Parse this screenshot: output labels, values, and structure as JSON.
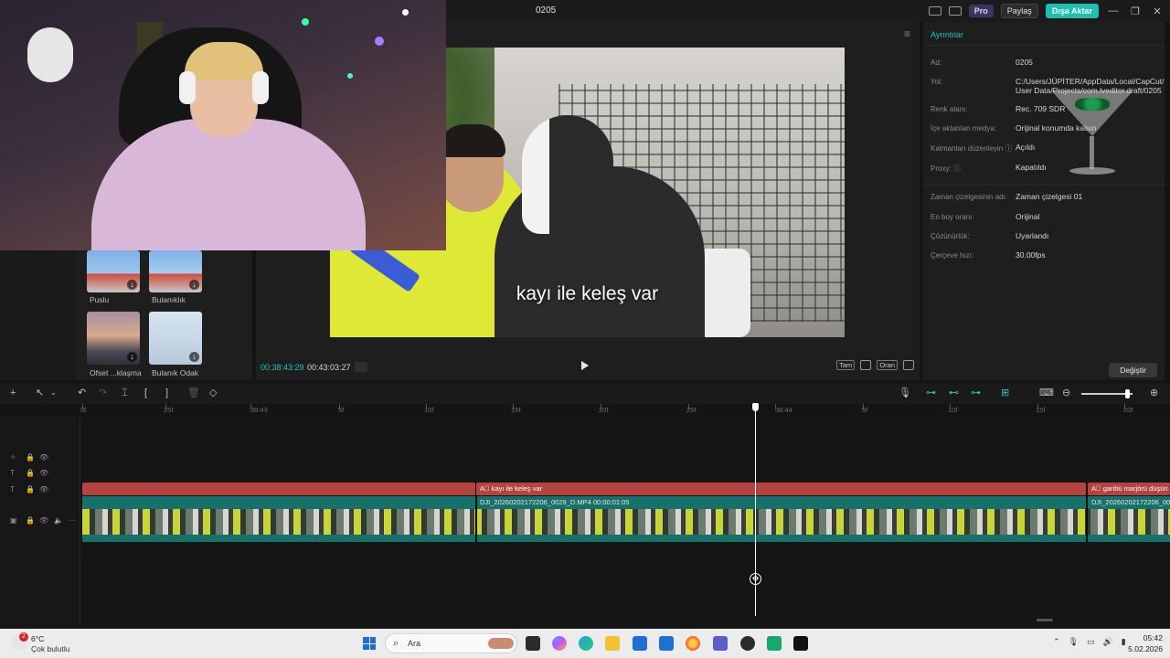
{
  "window": {
    "project_title": "0205",
    "pro_label": "Pro",
    "share_label": "Paylaş",
    "export_label": "Dışa Aktar",
    "minimize": "—",
    "maximize": "❐",
    "close": "✕"
  },
  "media": {
    "items": [
      {
        "label": "Puslu"
      },
      {
        "label": "Bulanıklık"
      },
      {
        "label": "Ofset ...klaşma"
      },
      {
        "label": "Bulanık Odak"
      }
    ]
  },
  "player": {
    "caption": "kayı ile keleş var",
    "current_time": "00:38:43:29",
    "total_time": "00:43:03:27",
    "full_label": "Tam",
    "ratio_label": "Oran",
    "menu_icon": "≡"
  },
  "details": {
    "title": "Ayrıntılar",
    "rows": [
      {
        "label": "Ad:",
        "value": "0205"
      },
      {
        "label": "Yol:",
        "value": "C:/Users/JÜPİTER/AppData/Local/CapCut/ User Data/Projects/com.lveditor.draft/0205"
      },
      {
        "label": "Renk alanı:",
        "value": "Rec. 709 SDR"
      },
      {
        "label": "İçe aktarılan medya:",
        "value": "Orijinal konumda kalsın"
      },
      {
        "label": "Katmanları düzenleyin ⓘ",
        "value": "Açıldı"
      },
      {
        "label": "Proxy: ⓘ",
        "value": "Kapatıldı"
      },
      {
        "label": "Zaman çizelgesinin adı:",
        "value": "Zaman çizelgesi 01"
      },
      {
        "label": "En boy oranı:",
        "value": "Orijinal"
      },
      {
        "label": "Çözünürlük:",
        "value": "Uyarlandı"
      },
      {
        "label": "Çerçeve hızı:",
        "value": "30.00fps"
      }
    ],
    "change_label": "Değiştir"
  },
  "timeline": {
    "ruler_labels": [
      "0f",
      "25f",
      "38:43",
      "5f",
      "10f",
      "15f",
      "20f",
      "25f",
      "38:44",
      "5f",
      "10f",
      "15f",
      "20f"
    ],
    "text_clips": [
      {
        "label": "kayı ile keleş var"
      },
      {
        "label": "garibü marjörü düşün"
      }
    ],
    "video_clips": [
      {
        "label": "DJI_20260202172206_0029_D.MP4   00:00:01:05"
      },
      {
        "label": "DJI_20260202172206_00"
      }
    ]
  },
  "taskbar": {
    "weather_badge": "2",
    "temperature": "6°C",
    "weather_desc": "Çok bulutlu",
    "search_label": "Ara",
    "time": "05:42",
    "date": "5.02.2026"
  },
  "colors": {
    "accent": "#1fc7b7",
    "text_clip": "#b5433f",
    "video_track": "#16716a",
    "export_button": "#1fbfb0"
  }
}
